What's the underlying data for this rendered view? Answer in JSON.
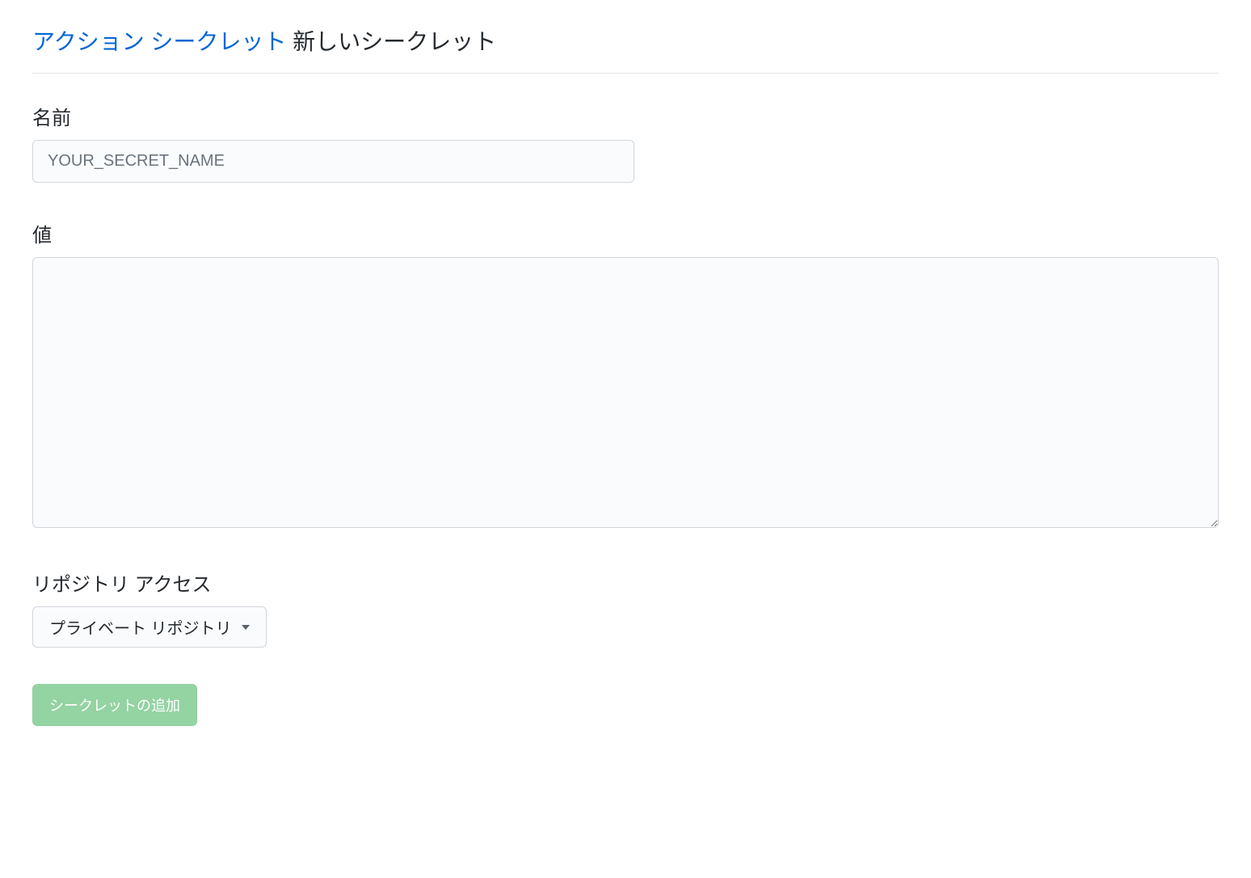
{
  "breadcrumb": {
    "link_text": "アクション シークレット",
    "current_text": "新しいシークレット"
  },
  "form": {
    "name_label": "名前",
    "name_placeholder": "YOUR_SECRET_NAME",
    "name_value": "",
    "value_label": "値",
    "value_content": "",
    "repo_access_label": "リポジトリ アクセス",
    "repo_access_selected": "プライベート リポジトリ",
    "submit_label": "シークレットの追加"
  }
}
